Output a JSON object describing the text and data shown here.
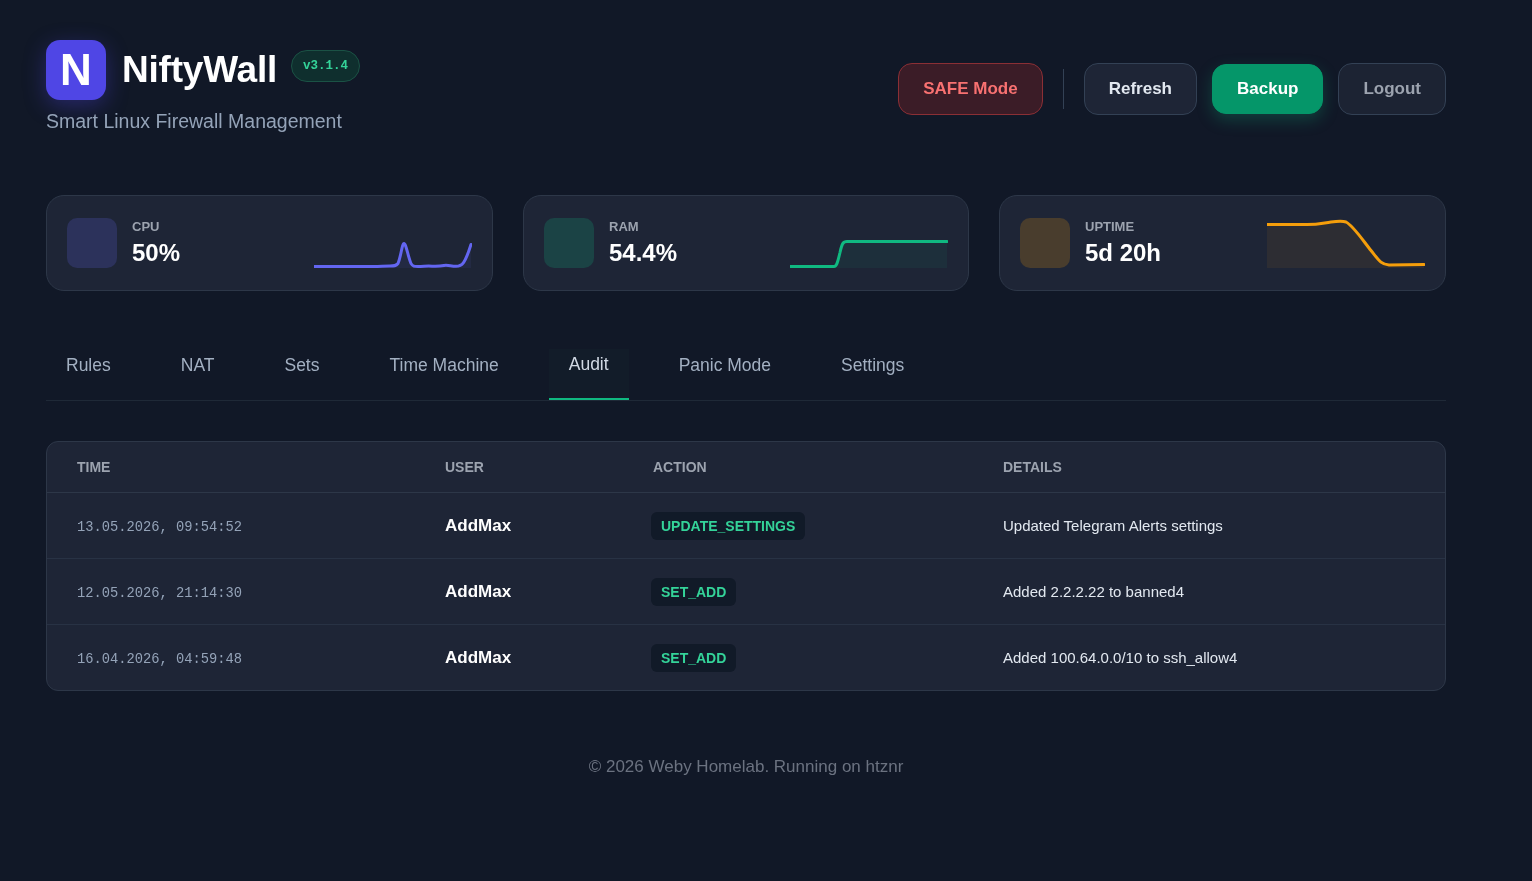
{
  "header": {
    "logo_letter": "N",
    "title": "NiftyWall",
    "version": "v3.1.4",
    "subtitle": "Smart Linux Firewall Management",
    "buttons": [
      {
        "label": "SAFE Mode",
        "kind": "danger"
      },
      {
        "label": "Refresh",
        "kind": "secondary"
      },
      {
        "label": "Backup",
        "kind": "primary"
      },
      {
        "label": "Logout",
        "kind": "muted"
      }
    ]
  },
  "stats": [
    {
      "label": "CPU",
      "value": "50%",
      "color": "#6366f1"
    },
    {
      "label": "RAM",
      "value": "54.4%",
      "color": "#10b981"
    },
    {
      "label": "UPTIME",
      "value": "5d 20h",
      "color": "#f59e0b"
    }
  ],
  "tabs": [
    {
      "label": "Rules",
      "selected": false
    },
    {
      "label": "NAT",
      "selected": false
    },
    {
      "label": "Sets",
      "selected": false
    },
    {
      "label": "Time Machine",
      "selected": false
    },
    {
      "label": "Audit",
      "selected": true
    },
    {
      "label": "Panic Mode",
      "selected": false
    },
    {
      "label": "Settings",
      "selected": false
    }
  ],
  "audit_table": {
    "columns": [
      "TIME",
      "USER",
      "ACTION",
      "DETAILS"
    ],
    "rows": [
      {
        "time": "13.05.2026, 09:54:52",
        "user": "AddMax",
        "action": "UPDATE_SETTINGS",
        "details": "Updated Telegram Alerts settings"
      },
      {
        "time": "12.05.2026, 21:14:30",
        "user": "AddMax",
        "action": "SET_ADD",
        "details": "Added 2.2.2.22 to banned4"
      },
      {
        "time": "16.04.2026, 04:59:48",
        "user": "AddMax",
        "action": "SET_ADD",
        "details": "Added 100.64.0.0/10 to ssh_allow4"
      }
    ]
  },
  "footer": "© 2026 Weby Homelab. Running on htznr"
}
